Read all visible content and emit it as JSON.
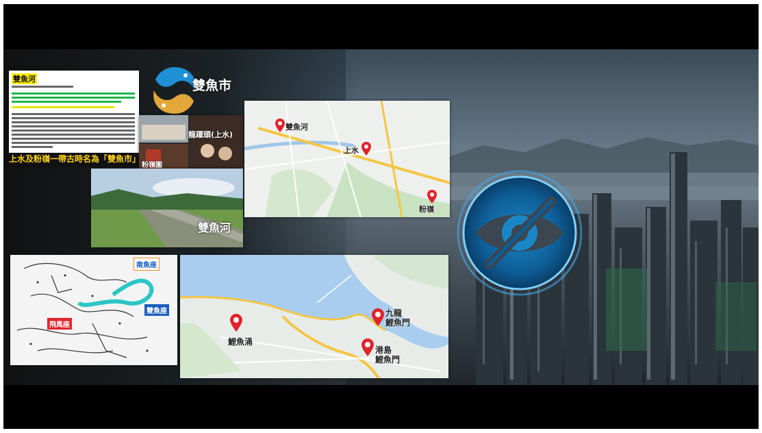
{
  "doc": {
    "title": "雙魚河",
    "caption": "上水及粉嶺一帶古時名為「雙魚市」"
  },
  "logo": {
    "text": "雙魚市"
  },
  "photos": {
    "label_top": "龍躍頭(上水)",
    "label_bottom": "粉嶺圍"
  },
  "river": {
    "label": "雙魚河"
  },
  "map1": {
    "labels": [
      "雙魚河",
      "上水",
      "粉嶺"
    ]
  },
  "stars": {
    "labels": [
      "南魚座",
      "雙魚座",
      "飛馬座"
    ]
  },
  "map2": {
    "labels": [
      "鯉魚涌",
      "九龍\n鯉魚門",
      "港島\n鯉魚門"
    ]
  },
  "colors": {
    "pin": "#e0242c",
    "eye_glow": "#3fa9e8",
    "road": "#f5c542",
    "sea": "#a9cdee"
  },
  "icons": [
    "fish-logo-icon",
    "map-pin-icon",
    "eye-slash-icon"
  ]
}
